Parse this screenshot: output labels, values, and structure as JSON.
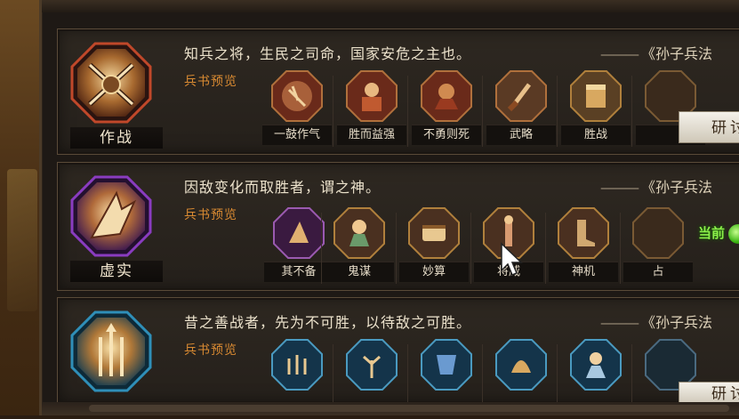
{
  "research_label": "研讨",
  "preview_label": "兵书预览",
  "source_text": "《孙子兵法",
  "cards": [
    {
      "name": "作战",
      "quote": "知兵之将，生民之司命，国家安危之主也。",
      "skills": [
        {
          "name": "一鼓作气"
        },
        {
          "name": "胜而益强"
        },
        {
          "name": "不勇则死"
        },
        {
          "name": "武略"
        },
        {
          "name": "胜战"
        },
        {
          "name": ""
        }
      ]
    },
    {
      "name": "虚实",
      "quote": "因敌变化而取胜者，谓之神。",
      "current_tag": "当前",
      "skills": [
        {
          "name": "其不备"
        },
        {
          "name": "鬼谋"
        },
        {
          "name": "妙算"
        },
        {
          "name": "将威"
        },
        {
          "name": "神机"
        },
        {
          "name": "占"
        }
      ]
    },
    {
      "name": "",
      "quote": "昔之善战者，先为不可胜，以待敌之可胜。",
      "skills": [
        {
          "name": ""
        },
        {
          "name": ""
        },
        {
          "name": ""
        },
        {
          "name": ""
        },
        {
          "name": ""
        },
        {
          "name": ""
        }
      ]
    }
  ],
  "colors": {
    "accent_orange": "#d98a32",
    "badge_red": "#c0482a",
    "badge_purple": "#8a3cc0",
    "badge_blue": "#2f8fb8",
    "current_green": "#8cf04a"
  }
}
